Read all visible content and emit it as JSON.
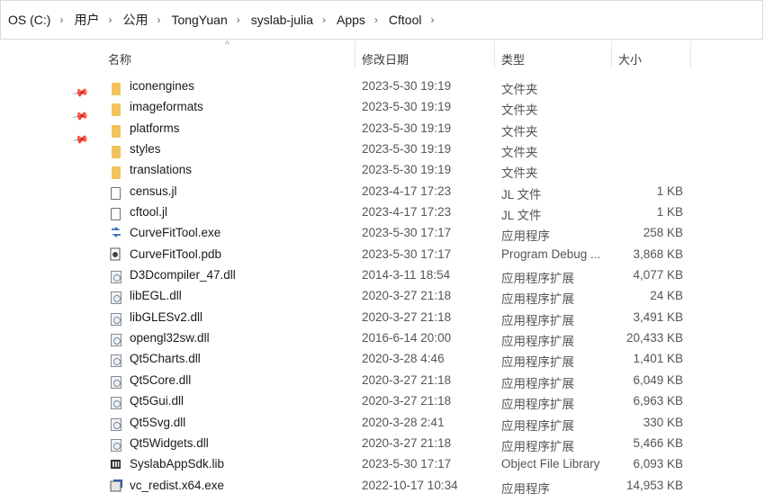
{
  "breadcrumb": [
    "OS (C:)",
    "用户",
    "公用",
    "TongYuan",
    "syslab-julia",
    "Apps",
    "Cftool"
  ],
  "columns": {
    "name": "名称",
    "date": "修改日期",
    "type": "类型",
    "size": "大小"
  },
  "files": [
    {
      "name": "iconengines",
      "date": "2023-5-30 19:19",
      "type": "文件夹",
      "size": "",
      "icon": "folder-icon"
    },
    {
      "name": "imageformats",
      "date": "2023-5-30 19:19",
      "type": "文件夹",
      "size": "",
      "icon": "folder-icon"
    },
    {
      "name": "platforms",
      "date": "2023-5-30 19:19",
      "type": "文件夹",
      "size": "",
      "icon": "folder-icon"
    },
    {
      "name": "styles",
      "date": "2023-5-30 19:19",
      "type": "文件夹",
      "size": "",
      "icon": "folder-icon"
    },
    {
      "name": "translations",
      "date": "2023-5-30 19:19",
      "type": "文件夹",
      "size": "",
      "icon": "folder-icon"
    },
    {
      "name": "census.jl",
      "date": "2023-4-17 17:23",
      "type": "JL 文件",
      "size": "1 KB",
      "icon": "file-icon"
    },
    {
      "name": "cftool.jl",
      "date": "2023-4-17 17:23",
      "type": "JL 文件",
      "size": "1 KB",
      "icon": "file-icon"
    },
    {
      "name": "CurveFitTool.exe",
      "date": "2023-5-30 17:17",
      "type": "应用程序",
      "size": "258 KB",
      "icon": "exe-icon"
    },
    {
      "name": "CurveFitTool.pdb",
      "date": "2023-5-30 17:17",
      "type": "Program Debug ...",
      "size": "3,868 KB",
      "icon": "pdb-icon"
    },
    {
      "name": "D3Dcompiler_47.dll",
      "date": "2014-3-11 18:54",
      "type": "应用程序扩展",
      "size": "4,077 KB",
      "icon": "dll-icon"
    },
    {
      "name": "libEGL.dll",
      "date": "2020-3-27 21:18",
      "type": "应用程序扩展",
      "size": "24 KB",
      "icon": "dll-icon"
    },
    {
      "name": "libGLESv2.dll",
      "date": "2020-3-27 21:18",
      "type": "应用程序扩展",
      "size": "3,491 KB",
      "icon": "dll-icon"
    },
    {
      "name": "opengl32sw.dll",
      "date": "2016-6-14 20:00",
      "type": "应用程序扩展",
      "size": "20,433 KB",
      "icon": "dll-icon"
    },
    {
      "name": "Qt5Charts.dll",
      "date": "2020-3-28 4:46",
      "type": "应用程序扩展",
      "size": "1,401 KB",
      "icon": "dll-icon"
    },
    {
      "name": "Qt5Core.dll",
      "date": "2020-3-27 21:18",
      "type": "应用程序扩展",
      "size": "6,049 KB",
      "icon": "dll-icon"
    },
    {
      "name": "Qt5Gui.dll",
      "date": "2020-3-27 21:18",
      "type": "应用程序扩展",
      "size": "6,963 KB",
      "icon": "dll-icon"
    },
    {
      "name": "Qt5Svg.dll",
      "date": "2020-3-28 2:41",
      "type": "应用程序扩展",
      "size": "330 KB",
      "icon": "dll-icon"
    },
    {
      "name": "Qt5Widgets.dll",
      "date": "2020-3-27 21:18",
      "type": "应用程序扩展",
      "size": "5,466 KB",
      "icon": "dll-icon"
    },
    {
      "name": "SyslabAppSdk.lib",
      "date": "2023-5-30 17:17",
      "type": "Object File Library",
      "size": "6,093 KB",
      "icon": "lib-icon"
    },
    {
      "name": "vc_redist.x64.exe",
      "date": "2022-10-17 10:34",
      "type": "应用程序",
      "size": "14,953 KB",
      "icon": "installer-icon"
    }
  ]
}
